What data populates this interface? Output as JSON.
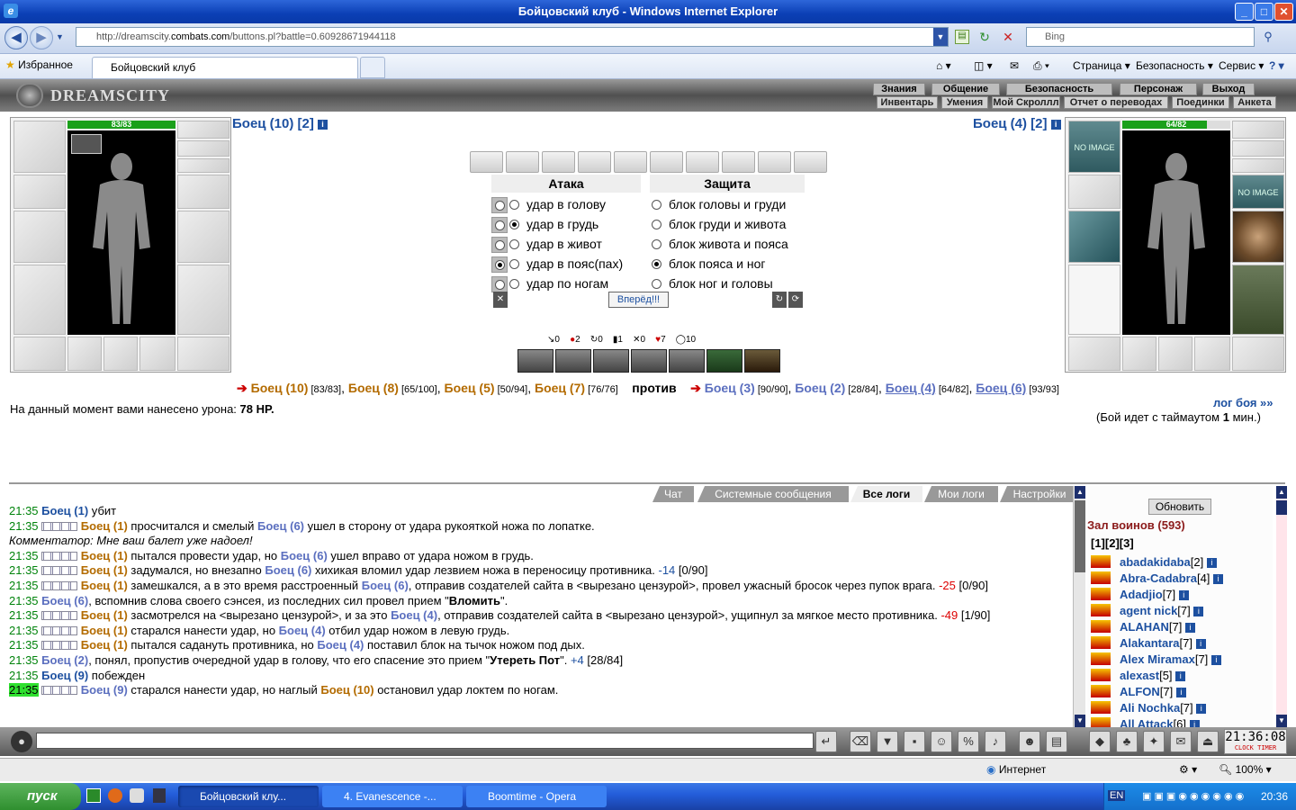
{
  "window": {
    "title": "Бойцовский клуб - Windows Internet Explorer"
  },
  "browser": {
    "url_prefix": "http://dreamscity.",
    "url_host": "combats.com",
    "url_path": "/buttons.pl?battle=0.60928671944118",
    "search_placeholder": "Bing",
    "favorites_label": "Избранное",
    "tab_title": "Бойцовский клуб",
    "tools": [
      "Страница ▾",
      "Безопасность ▾",
      "Сервис ▾"
    ]
  },
  "game": {
    "logo": "DREAMSCITY",
    "menu_top": [
      "Знания",
      "Общение",
      "Безопасность",
      "Персонаж",
      "Выход"
    ],
    "menu_bottom": [
      "Инвентарь",
      "Умения",
      "Мой Скроллл",
      "Отчет о переводах",
      "Поединки",
      "Анкета"
    ],
    "left_fighter": {
      "name": "Боец (10) [2]",
      "hp": "83/83",
      "hp_fraction": 1.0
    },
    "right_fighter": {
      "name": "Боец (4) [2]",
      "hp": "64/82",
      "hp_fraction": 0.78
    },
    "no_image": "NO IMAGE",
    "attack_header": "Атака",
    "defense_header": "Защита",
    "attack_options": [
      "удар в голову",
      "удар в грудь",
      "удар в живот",
      "удар в пояс(пах)",
      "удар по ногам"
    ],
    "attack_selected": 1,
    "defense_options": [
      "блок головы и груди",
      "блок груди и живота",
      "блок живота и пояса",
      "блок пояса и ног",
      "блок ног и головы"
    ],
    "defense_selected": 3,
    "go_button": "Вперёд!!!",
    "stats": [
      "0",
      "2",
      "0",
      "1",
      "0",
      "7",
      "10"
    ],
    "team_a": [
      {
        "name": "Боец (10)",
        "hp": "[83/83]"
      },
      {
        "name": "Боец (8)",
        "hp": "[65/100]"
      },
      {
        "name": "Боец (5)",
        "hp": "[50/94]"
      },
      {
        "name": "Боец (7)",
        "hp": "[76/76]"
      }
    ],
    "versus": "против",
    "team_b": [
      {
        "name": "Боец (3)",
        "hp": "[90/90]"
      },
      {
        "name": "Боец (2)",
        "hp": "[28/84]"
      },
      {
        "name": "Боец (4)",
        "hp": "[64/82]"
      },
      {
        "name": "Боец (6)",
        "hp": "[93/93]"
      }
    ],
    "damage_text": "На данный момент вами нанесено урона:",
    "damage_value": "78 HP.",
    "log_link": "лог боя »»",
    "timeout_pre": "(Бой идет с таймаутом",
    "timeout_val": "1",
    "timeout_post": "мин.)"
  },
  "chat": {
    "tabs": [
      "Чат",
      "Системные сообщения",
      "Все логи",
      "Мои логи",
      "Настройки"
    ],
    "active_tab": "Все логи",
    "refresh": "Обновить",
    "hall_title": "Зал воинов (593)",
    "pages": "[1][2][3]",
    "users": [
      {
        "name": "abadakidaba",
        "lvl": "[2]"
      },
      {
        "name": "Abra-Cadabra",
        "lvl": "[4]"
      },
      {
        "name": "Adadjio",
        "lvl": "[7]"
      },
      {
        "name": "agent nick",
        "lvl": "[7]"
      },
      {
        "name": "ALAHAN",
        "lvl": "[7]"
      },
      {
        "name": "Alakantara",
        "lvl": "[7]"
      },
      {
        "name": "Alex Miramax",
        "lvl": "[7]"
      },
      {
        "name": "alexast",
        "lvl": "[5]"
      },
      {
        "name": "ALFON",
        "lvl": "[7]"
      },
      {
        "name": "Ali Nochka",
        "lvl": "[7]"
      },
      {
        "name": "All Attack",
        "lvl": "[6]"
      }
    ],
    "log": [
      {
        "t": "21:35",
        "html": "<span class='fb'>Боец (1)</span> убит"
      },
      {
        "t": "21:35",
        "hit": true,
        "html": "<span class='f1'>Боец (1)</span> просчитался и смелый <span class='f2'>Боец (6)</span> ушел в сторону от удара рукояткой ножа по лопатке."
      },
      {
        "t": "",
        "html": "<i>Комментатор: Мне ваш балет уже надоел!</i>"
      },
      {
        "t": "21:35",
        "hit": true,
        "html": "<span class='f1'>Боец (1)</span> пытался провести удар, но <span class='f2'>Боец (6)</span> ушел вправо от удара ножом в грудь."
      },
      {
        "t": "21:35",
        "hit": true,
        "html": "<span class='f1'>Боец (1)</span> задумался, но внезапно <span class='f2'>Боец (6)</span> хихикая вломил удар лезвием ножа в переносицу противника. <span class='blu'>-14</span> [0/90]"
      },
      {
        "t": "21:35",
        "hit": true,
        "html": "<span class='f1'>Боец (1)</span> замешкался, а в это время расстроенный <span class='f2'>Боец (6)</span>, отправив создателей сайта в &lt;вырезано цензурой&gt;, провел ужасный бросок через пупок врага. <span class='red'>-25</span> [0/90]"
      },
      {
        "t": "21:35",
        "html": "<span class='f2'>Боец (6)</span>, вспомнив слова своего сэнсея, из последних сил провел прием \"<b>Вломить</b>\"."
      },
      {
        "t": "21:35",
        "hit": true,
        "html": "<span class='f1'>Боец (1)</span> засмотрелся на &lt;вырезано цензурой&gt;, и за это <span class='f2'>Боец (4)</span>, отправив создателей сайта в &lt;вырезано цензурой&gt;, ущипнул за мягкое место противника. <span class='red'>-49</span> [1/90]"
      },
      {
        "t": "21:35",
        "hit": true,
        "html": "<span class='f1'>Боец (1)</span> старался нанести удар, но <span class='f2'>Боец (4)</span> отбил удар ножом в левую грудь."
      },
      {
        "t": "21:35",
        "hit": true,
        "html": "<span class='f1'>Боец (1)</span> пытался садануть противника, но <span class='f2'>Боец (4)</span> поставил блок на тычок ножом под дых."
      },
      {
        "t": "21:35",
        "html": "<span class='f2'>Боец (2)</span>, понял, пропустив очередной удар в голову, что его спасение это прием \"<b>Утереть Пот</b>\". <span class='blu'>+4</span> [28/84]"
      },
      {
        "t": "21:35",
        "html": "<span class='fb'>Боец (9)</span> побежден"
      },
      {
        "t": "21:35",
        "hit": true,
        "html": "<span class='f2'>Боец (9)</span> старался нанести удар, но наглый <span class='f1'>Боец (10)</span> остановил удар локтем по ногам."
      }
    ],
    "clock": "21:36:08",
    "clock_label": "CLOCK TIMER"
  },
  "statusbar": {
    "zone": "Интернет",
    "zoom": "100%"
  },
  "taskbar": {
    "start": "пуск",
    "tasks": [
      "Бойцовский клу...",
      "4. Evanescence -...",
      "Boomtime - Opera"
    ],
    "lang": "EN",
    "time": "20:36"
  },
  "colors": {
    "teamA": "#b36b00",
    "teamB": "#5b6fbf",
    "time": "#00830b",
    "link": "#1d50a0"
  }
}
